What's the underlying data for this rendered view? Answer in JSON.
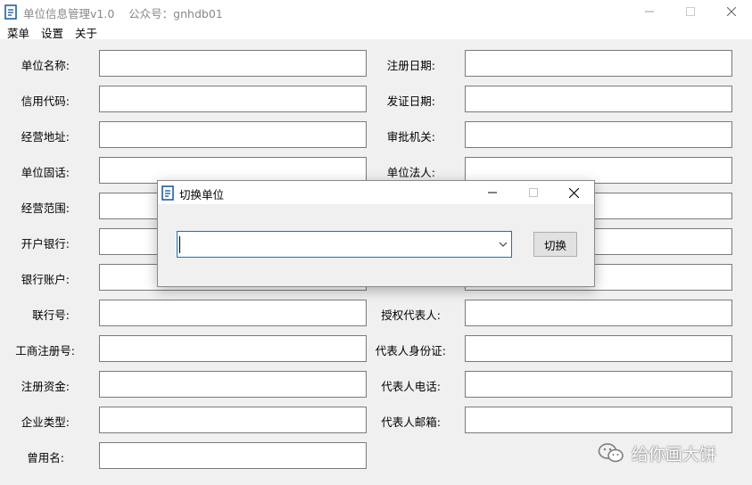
{
  "window": {
    "title": "单位信息管理v1.0    公众号：gnhdb01"
  },
  "menu": [
    "菜单",
    "设置",
    "关于"
  ],
  "form": {
    "left": [
      "单位名称:",
      "信用代码:",
      "经营地址:",
      "单位固话:",
      "经营范围:",
      "开户银行:",
      "银行账户:",
      "联行号:",
      "工商注册号:",
      "注册资金:",
      "企业类型:",
      "曾用名:"
    ],
    "right": [
      "注册日期:",
      "发证日期:",
      "审批机关:",
      "单位法人:",
      "",
      "",
      "",
      "授权代表人:",
      "代表人身份证:",
      "代表人电话:",
      "代表人邮箱:"
    ]
  },
  "dialog": {
    "title": "切换单位",
    "combo_value": "",
    "button_label": "切换"
  },
  "watermark": {
    "text": "给你画大饼"
  },
  "colors": {
    "accent": "#0078d7",
    "client_bg": "#f0f0f0",
    "icon_blue": "#1e5fa8"
  }
}
